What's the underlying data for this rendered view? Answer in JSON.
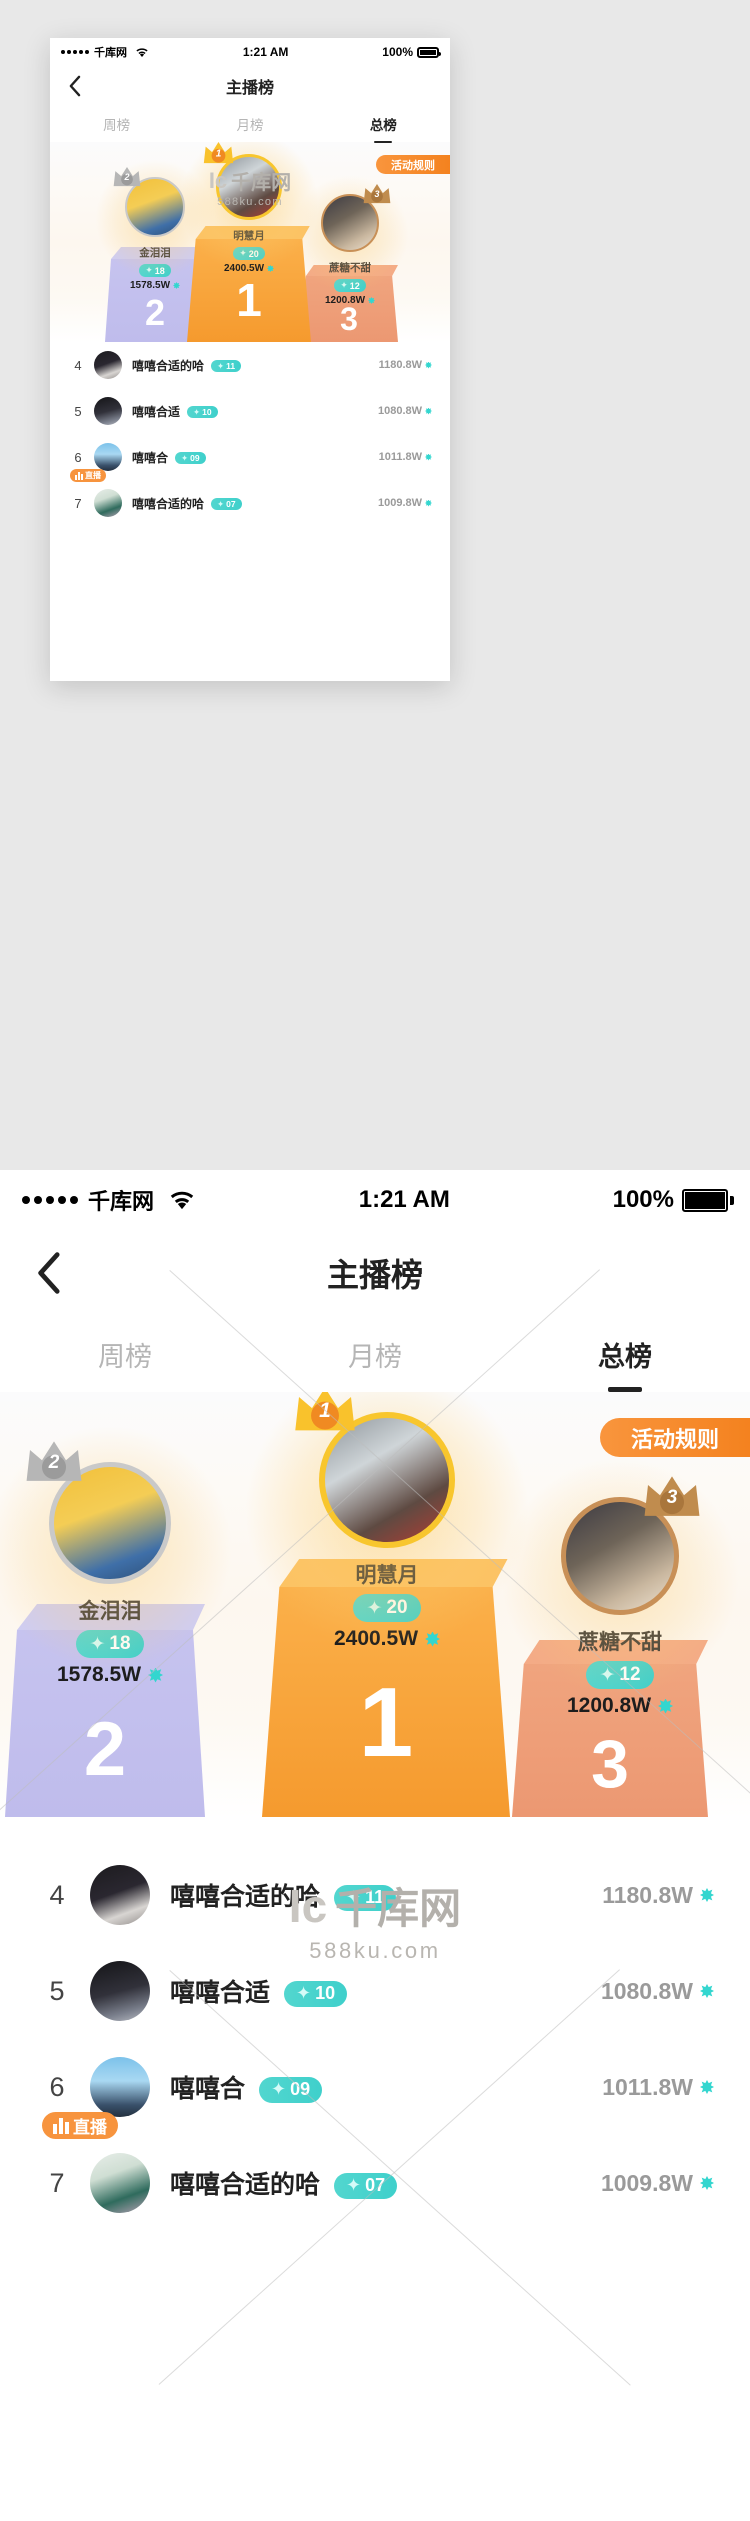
{
  "status_bar": {
    "carrier": "千库网",
    "signal_dots": 5,
    "wifi_icon": "wifi-icon",
    "time": "1:21 AM",
    "battery_percent": "100%",
    "battery_icon": "battery-full-icon"
  },
  "nav": {
    "back_icon": "chevron-left-icon",
    "title": "主播榜"
  },
  "tabs": [
    {
      "label": "周榜",
      "active": false
    },
    {
      "label": "月榜",
      "active": false
    },
    {
      "label": "总榜",
      "active": true
    }
  ],
  "stage": {
    "rule_button": "活动规则",
    "podium": [
      {
        "rank": "2",
        "rank_display": "2",
        "name": "金泪泪",
        "level": "18",
        "score": "1578.5W",
        "crown_icon": "silver-crown-icon",
        "crown_color": "#b6b6b6",
        "ring_color": "#c9c9c9",
        "block_color": "#c5c2ef",
        "gem_icon": "gem-icon",
        "level_spark_icon": "sparkle-icon"
      },
      {
        "rank": "1",
        "rank_display": "1",
        "name": "明慧月",
        "level": "20",
        "score": "2400.5W",
        "crown_icon": "gold-crown-icon",
        "crown_color": "#f9c22c",
        "ring_color": "#f8c62d",
        "block_color": "#f9ab3c",
        "gem_icon": "gem-icon",
        "level_spark_icon": "sparkle-icon"
      },
      {
        "rank": "3",
        "rank_display": "3",
        "name": "蔗糖不甜",
        "level": "12",
        "score": "1200.8W",
        "crown_icon": "bronze-crown-icon",
        "crown_color": "#c08c4e",
        "ring_color": "#c89057",
        "block_color": "#ef9f79",
        "gem_icon": "gem-icon",
        "level_spark_icon": "sparkle-icon"
      }
    ]
  },
  "list": {
    "rows": [
      {
        "rank": "4",
        "name": "嘻嘻合适的哈",
        "level": "11",
        "score": "1180.8W",
        "live": false,
        "avatar_class": "p-d"
      },
      {
        "rank": "5",
        "name": "嘻嘻合适",
        "level": "10",
        "score": "1080.8W",
        "live": false,
        "avatar_class": "p-e"
      },
      {
        "rank": "6",
        "name": "嘻嘻合",
        "level": "09",
        "score": "1011.8W",
        "live": true,
        "live_label": "直播",
        "live_icon": "live-bars-icon",
        "avatar_class": "p-f"
      },
      {
        "rank": "7",
        "name": "嘻嘻合适的哈",
        "level": "07",
        "score": "1009.8W",
        "live": false,
        "avatar_class": "p-g"
      }
    ]
  },
  "watermark": {
    "bracket": "Ic",
    "text": "千库网",
    "site": "588ku.com"
  },
  "colors": {
    "accent_orange": "#f4821f",
    "level_teal": "#3fd0cb",
    "gem_teal": "#33d6cf",
    "gold": "#f9ab3c",
    "silver": "#c5c2ef",
    "bronze": "#ef9f79",
    "page_bg": "#e8e8e8"
  }
}
